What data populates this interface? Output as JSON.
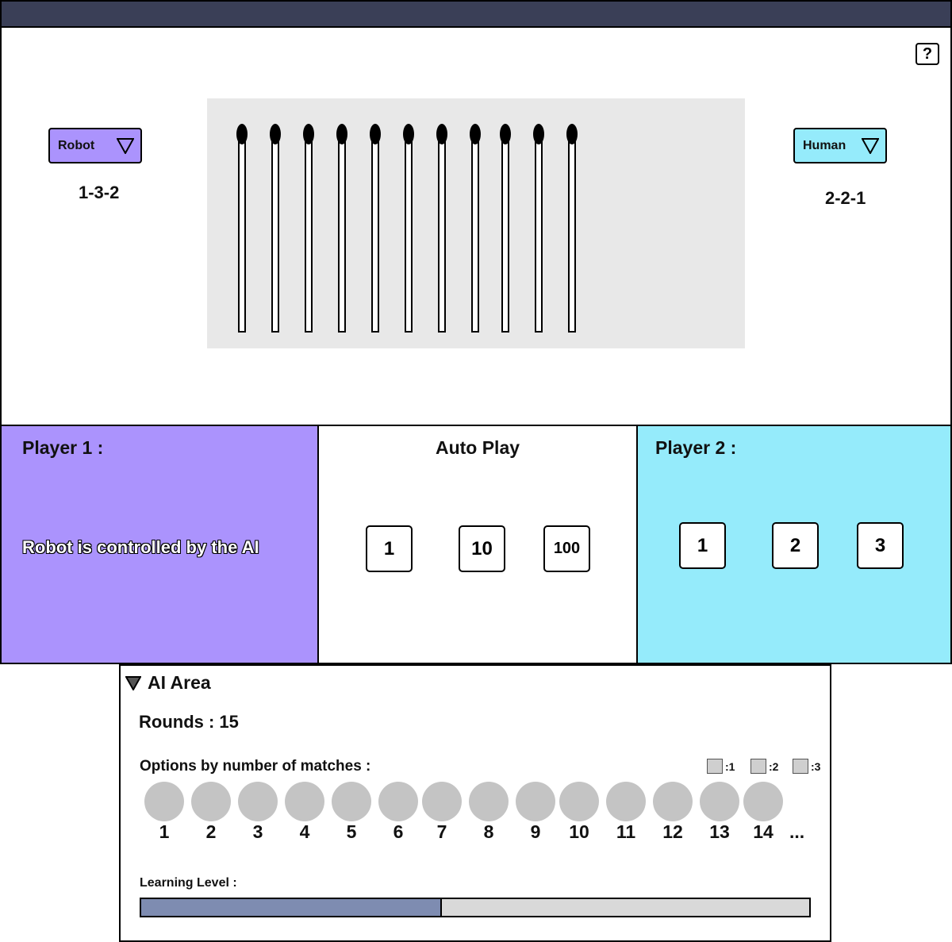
{
  "window": {
    "titlebar_color": "#3a3f57"
  },
  "help": {
    "label": "?"
  },
  "player_left": {
    "type_selected": "Robot",
    "sequence": "1-3-2",
    "color": "#ab93fd"
  },
  "player_right": {
    "type_selected": "Human",
    "sequence": "2-2-1",
    "color": "#95ebfb"
  },
  "board": {
    "match_count": 11,
    "match_head_color": "#000000"
  },
  "panels": {
    "player1": {
      "title": "Player 1 :",
      "message": "Robot is controlled by the AI"
    },
    "autoplay": {
      "title": "Auto Play",
      "buttons": [
        "1",
        "10",
        "100"
      ]
    },
    "player2": {
      "title": "Player 2 :",
      "buttons": [
        "1",
        "2",
        "3"
      ]
    }
  },
  "ai_area": {
    "toggle_label": "AI Area",
    "rounds": "Rounds : 15",
    "options_label": "Options by number of matches :",
    "legend": [
      ":1",
      ":2",
      ":3"
    ],
    "option_numbers": [
      "1",
      "2",
      "3",
      "4",
      "5",
      "6",
      "7",
      "8",
      "9",
      "10",
      "11",
      "12",
      "13",
      "14"
    ],
    "ellipsis": "...",
    "learning_label": "Learning Level :",
    "learning_level": 0.45
  }
}
